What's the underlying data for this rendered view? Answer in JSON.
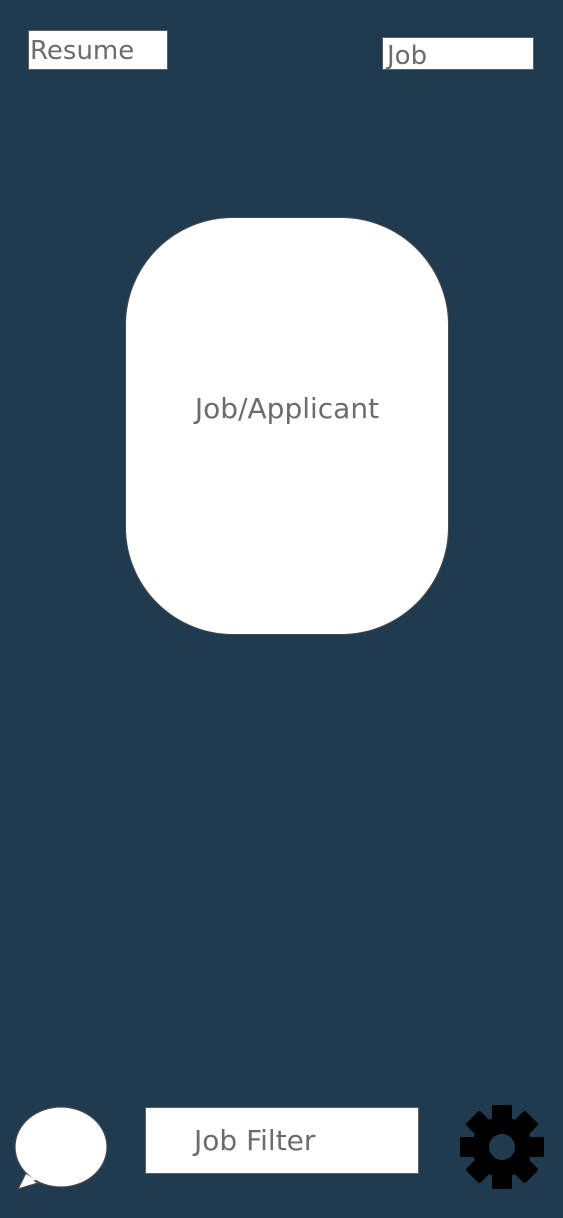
{
  "header": {
    "resume_label": "Resume",
    "job_label": "Job"
  },
  "card": {
    "label": "Job/Applicant"
  },
  "bottom_bar": {
    "chat_icon": "speech-bubble-icon",
    "filter_label": "Job Filter",
    "settings_icon": "gear-icon"
  },
  "colors": {
    "background": "#203b50",
    "surface": "#ffffff",
    "text": "#6c6c6c",
    "icon": "#000000"
  }
}
